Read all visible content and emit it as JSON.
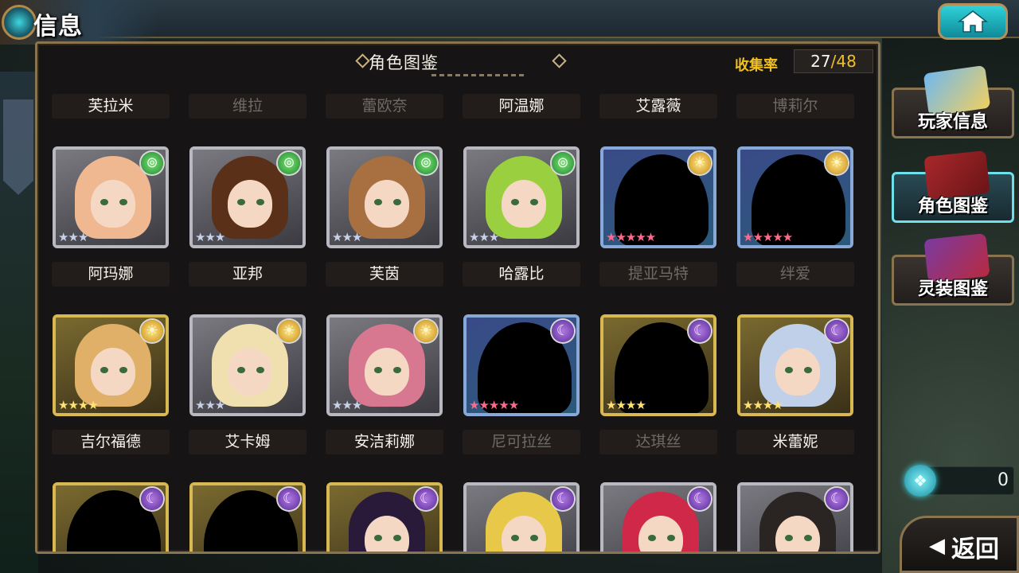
{
  "header": {
    "title": "信息"
  },
  "panel": {
    "title": "角色图鉴",
    "collection_label": "收集率",
    "collected": "27",
    "separator": "/",
    "total": "48"
  },
  "characters": [
    {
      "name": "芙拉米",
      "known": true,
      "element": "wind",
      "stars": "★★★",
      "frame": "silver",
      "hair": "#f0b890",
      "silhouette": false
    },
    {
      "name": "维拉",
      "known": false,
      "element": "wind",
      "stars": "★★★",
      "frame": "silver",
      "hair": "#5a3018",
      "silhouette": false
    },
    {
      "name": "蕾欧奈",
      "known": false,
      "element": "wind",
      "stars": "★★★",
      "frame": "silver",
      "hair": "#a87040",
      "silhouette": false
    },
    {
      "name": "阿温娜",
      "known": true,
      "element": "wind",
      "stars": "★★★",
      "frame": "silver",
      "hair": "#9ad040",
      "silhouette": false
    },
    {
      "name": "艾露薇",
      "known": true,
      "element": "sun",
      "stars": "★★★★★",
      "frame": "blue",
      "hair": "#000000",
      "silhouette": true
    },
    {
      "name": "博莉尔",
      "known": false,
      "element": "sun",
      "stars": "★★★★★",
      "frame": "blue",
      "hair": "#000000",
      "silhouette": true
    },
    {
      "name": "阿玛娜",
      "known": true,
      "element": "sun",
      "stars": "★★★★",
      "frame": "gold",
      "hair": "#e0b068",
      "silhouette": false
    },
    {
      "name": "亚邦",
      "known": true,
      "element": "sun",
      "stars": "★★★",
      "frame": "silver",
      "hair": "#f0e0b0",
      "silhouette": false
    },
    {
      "name": "芙茵",
      "known": true,
      "element": "sun",
      "stars": "★★★",
      "frame": "silver",
      "hair": "#d87890",
      "silhouette": false
    },
    {
      "name": "哈露比",
      "known": true,
      "element": "moon",
      "stars": "★★★★★",
      "frame": "blue",
      "hair": "#000000",
      "silhouette": true
    },
    {
      "name": "提亚马特",
      "known": false,
      "element": "moon",
      "stars": "★★★★",
      "frame": "gold",
      "hair": "#000000",
      "silhouette": true
    },
    {
      "name": "绊爱",
      "known": false,
      "element": "moon",
      "stars": "★★★★",
      "frame": "gold",
      "hair": "#c0d0e8",
      "silhouette": false
    },
    {
      "name": "吉尔福德",
      "known": true,
      "element": "moon",
      "stars": "",
      "frame": "gold",
      "hair": "#000000",
      "silhouette": true
    },
    {
      "name": "艾卡姆",
      "known": true,
      "element": "moon",
      "stars": "",
      "frame": "gold",
      "hair": "#000000",
      "silhouette": true
    },
    {
      "name": "安洁莉娜",
      "known": true,
      "element": "moon",
      "stars": "",
      "frame": "gold",
      "hair": "#2a1a3a",
      "silhouette": false
    },
    {
      "name": "尼可拉丝",
      "known": false,
      "element": "moon",
      "stars": "",
      "frame": "silver",
      "hair": "#e8c848",
      "silhouette": false
    },
    {
      "name": "达琪丝",
      "known": false,
      "element": "moon",
      "stars": "",
      "frame": "silver",
      "hair": "#d02848",
      "silhouette": false
    },
    {
      "name": "米蕾妮",
      "known": true,
      "element": "moon",
      "stars": "",
      "frame": "silver",
      "hair": "#2a2422",
      "silhouette": false
    }
  ],
  "element_glyphs": {
    "wind": "⊚",
    "sun": "☀",
    "moon": "☾"
  },
  "sidebar": [
    {
      "label": "玩家信息",
      "active": false
    },
    {
      "label": "角色图鉴",
      "active": true
    },
    {
      "label": "灵装图鉴",
      "active": false
    }
  ],
  "currency": {
    "value": "0",
    "icon": "gem-icon"
  },
  "back": {
    "label": "返回",
    "arrow": "◀"
  },
  "colors": {
    "accent_gold": "#f0c020",
    "accent_cyan": "#3fd7e0",
    "frame_brown": "#8a7450"
  }
}
